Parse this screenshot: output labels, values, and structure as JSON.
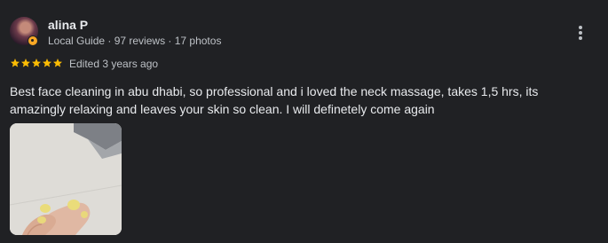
{
  "reviewer": {
    "name": "alina P",
    "meta": "Local Guide · 97 reviews · 17 photos"
  },
  "rating": {
    "stars": 5,
    "max": 5,
    "color": "#fbbc04"
  },
  "edited_label": "Edited 3 years ago",
  "review_text": "Best face cleaning in abu dhabi, so professional and i loved the neck massage, takes 1,5 hrs, its amazingly relaxing and leaves your skin so clean. I will definetely come again",
  "icons": {
    "more": "more-vertical-icon",
    "star": "star-icon",
    "badge": "local-guide-badge-icon"
  }
}
